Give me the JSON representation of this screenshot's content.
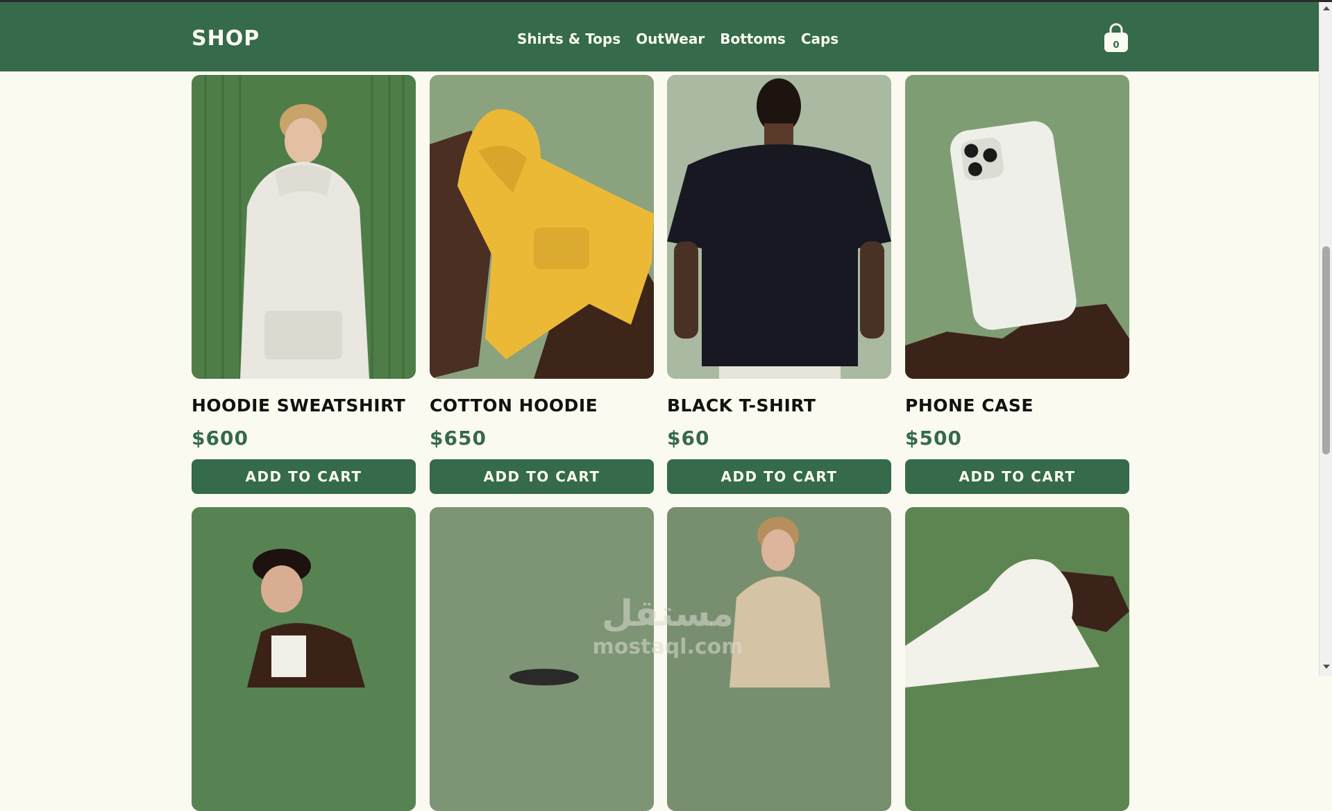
{
  "brand": {
    "logo": "SHOP"
  },
  "nav": {
    "links": [
      "Shirts & Tops",
      "OutWear",
      "Bottoms",
      "Caps"
    ]
  },
  "cart": {
    "icon": "shopping-bag-icon",
    "count": "0"
  },
  "products": [
    {
      "name": "HOODIE SWEATSHIRT",
      "price": "$600",
      "button": "ADD TO CART"
    },
    {
      "name": "COTTON HOODIE",
      "price": "$650",
      "button": "ADD TO CART"
    },
    {
      "name": "BLACK T-SHIRT",
      "price": "$60",
      "button": "ADD TO CART"
    },
    {
      "name": "PHONE CASE",
      "price": "$500",
      "button": "ADD TO CART"
    }
  ],
  "watermark": {
    "arabic": "مستقل",
    "latin": "mostaql.com"
  },
  "colors": {
    "primary": "#356a4a",
    "background": "#fafaf0",
    "text": "#111111"
  }
}
